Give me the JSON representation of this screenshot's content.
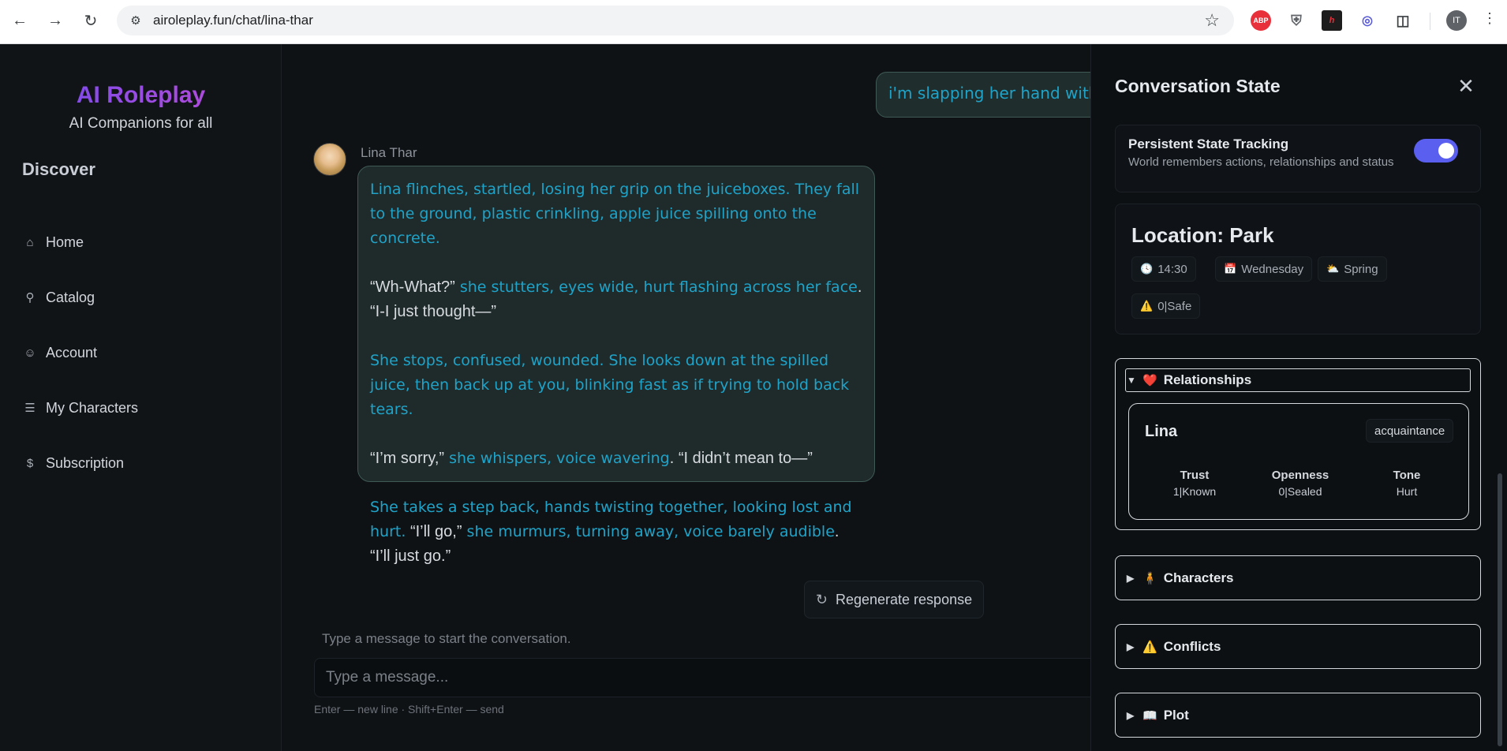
{
  "browser": {
    "url": "airoleplay.fun/chat/lina-thar",
    "profile_initials": "IT",
    "ext_abp": "ABP",
    "ext_h": "h"
  },
  "sidebar": {
    "brand": "AI Roleplay",
    "tagline": "AI Companions for all",
    "section": "Discover",
    "items": [
      {
        "label": "Home",
        "icon": "home-icon"
      },
      {
        "label": "Catalog",
        "icon": "search-icon"
      },
      {
        "label": "Account",
        "icon": "user-circle-icon"
      },
      {
        "label": "My Characters",
        "icon": "list-icon"
      },
      {
        "label": "Subscription",
        "icon": "dollar-icon"
      }
    ]
  },
  "chat": {
    "user_message": "i'm slapping her hand with",
    "character_name": "Lina Thar",
    "ai_message": {
      "p1": "Lina flinches, startled, losing her grip on the juiceboxes. They fall to the ground, plastic crinkling, apple juice spilling onto the concrete.",
      "p2a": "“Wh-What?”",
      "p2b": " she stutters, eyes wide, hurt flashing across her face",
      "p2c": ". “I-I just thought—”",
      "p3": "She stops, confused, wounded. She looks down at the spilled juice, then back up at you, blinking fast as if trying to hold back tears.",
      "p4a": "“I’m sorry,”",
      "p4b": " she whispers, voice wavering",
      "p4c": ". “I didn’t mean to—”",
      "p5a": "She takes a step back, hands twisting together, looking lost and hurt.",
      "p5b": " “I’ll go,”",
      "p5c": " she murmurs, turning away, voice barely audible",
      "p5d": ". “I’ll just go.”"
    },
    "regenerate_label": "Regenerate response",
    "hint": "Type a message to start the conversation.",
    "input_placeholder": "Type a message...",
    "shortcut_hint": "Enter — new line · Shift+Enter — send"
  },
  "panel": {
    "title": "Conversation State",
    "tracking_title": "Persistent State Tracking",
    "tracking_subtitle": "World remembers actions, relationships and status",
    "tracking_enabled": true,
    "location": "Location: Park",
    "chips": {
      "time": "14:30",
      "day": "Wednesday",
      "season": "Spring",
      "danger": "0|Safe"
    },
    "sections": {
      "relationships": "Relationships",
      "characters": "Characters",
      "conflicts": "Conflicts",
      "plot": "Plot"
    },
    "relationship": {
      "name": "Lina",
      "badge": "acquaintance",
      "stats": [
        {
          "label": "Trust",
          "value": "1|Known"
        },
        {
          "label": "Openness",
          "value": "0|Sealed"
        },
        {
          "label": "Tone",
          "value": "Hurt"
        }
      ]
    }
  }
}
